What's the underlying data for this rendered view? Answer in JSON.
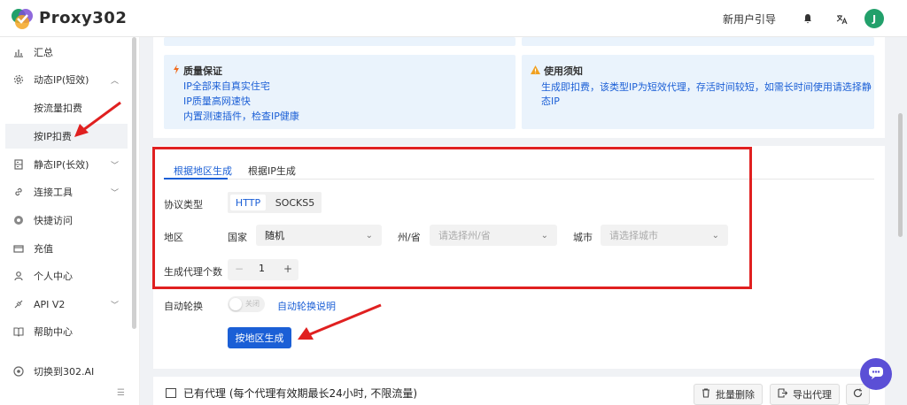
{
  "header": {
    "logo_text": "Proxy302",
    "guide_label": "新用户引导",
    "avatar_letter": "J",
    "brand_color": "#22a06b"
  },
  "sidebar": {
    "items": [
      {
        "label": "汇总",
        "icon": "chart-bar-icon"
      },
      {
        "label": "动态IP(短效)",
        "icon": "gear-icon"
      },
      {
        "label": "静态IP(长效)",
        "icon": "server-icon"
      },
      {
        "label": "连接工具",
        "icon": "link-icon"
      },
      {
        "label": "快捷访问",
        "icon": "chrome-icon"
      },
      {
        "label": "充值",
        "icon": "wallet-icon"
      },
      {
        "label": "个人中心",
        "icon": "user-icon"
      },
      {
        "label": "API V2",
        "icon": "api-icon"
      },
      {
        "label": "帮助中心",
        "icon": "book-icon"
      },
      {
        "label": "切换到302.AI",
        "icon": "switch-icon"
      }
    ],
    "sub_items": [
      {
        "label": "按流量扣费"
      },
      {
        "label": "按IP扣费"
      }
    ]
  },
  "info": {
    "quality_title": "质量保证",
    "quality_lines": [
      "IP全部来自真实住宅",
      "IP质量高网速快",
      "内置测速插件，检查IP健康"
    ],
    "notice_title": "使用须知",
    "notice_text": "生成即扣费，该类型IP为短效代理，存活时间较短，如需长时间使用请选择静态IP"
  },
  "form": {
    "tabs": [
      "根据地区生成",
      "根据IP生成"
    ],
    "protocol_label": "协议类型",
    "protocol_options": [
      "HTTP",
      "SOCKS5"
    ],
    "region_label": "地区",
    "country_label": "国家",
    "country_value": "随机",
    "state_label": "州/省",
    "state_placeholder": "请选择州/省",
    "city_label": "城市",
    "city_placeholder": "请选择城市",
    "count_label": "生成代理个数",
    "count_value": "1",
    "auto_rotate_label": "自动轮换",
    "auto_rotate_toggle_text": "关闭",
    "auto_rotate_link": "自动轮换说明",
    "generate_button": "按地区生成"
  },
  "proxies": {
    "title": "已有代理 (每个代理有效期最长24小时, 不限流量)",
    "batch_delete": "批量删除",
    "export": "导出代理"
  },
  "colors": {
    "accent": "#1b5fd6",
    "highlight": "#e02020"
  }
}
